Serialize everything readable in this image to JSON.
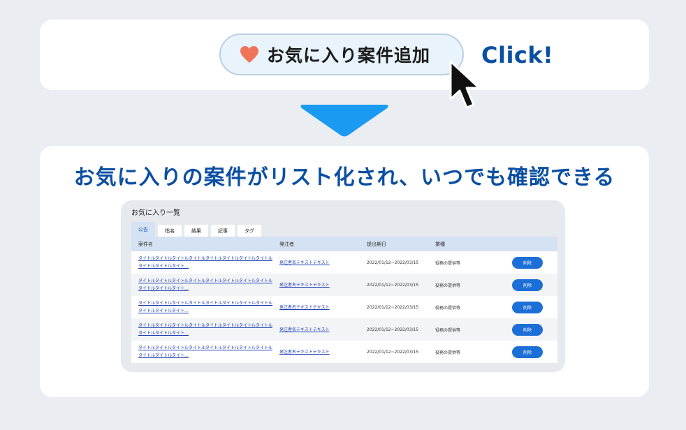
{
  "top": {
    "button_label": "お気に入り案件追加",
    "click_label": "Click!"
  },
  "bottom": {
    "headline": "お気に入りの案件がリスト化され、いつでも確認できる",
    "panel": {
      "title": "お気に入り一覧",
      "tabs": [
        {
          "label": "公告",
          "active": true
        },
        {
          "label": "指名",
          "active": false
        },
        {
          "label": "結果",
          "active": false
        },
        {
          "label": "記事",
          "active": false
        },
        {
          "label": "タグ",
          "active": false
        }
      ],
      "columns": [
        "案件名",
        "発注者",
        "提出期日",
        "業種"
      ],
      "rows": [
        {
          "title_line1": "タイトルタイトルタイトルタイトルタイトルタイトルタイトルタイトル",
          "title_line2": "タイトルタイトルタイト…",
          "orderer": "発注者名テキストテキスト",
          "period": "2022/01/12~2022/03/15",
          "industry": "役務の提供等",
          "action": "削除"
        },
        {
          "title_line1": "タイトルタイトルタイトルタイトルタイトルタイトルタイトルタイトル",
          "title_line2": "タイトルタイトルタイト…",
          "orderer": "発注者名テキストテキスト",
          "period": "2022/01/12~2022/03/15",
          "industry": "役務の提供等",
          "action": "削除"
        },
        {
          "title_line1": "タイトルタイトルタイトルタイトルタイトルタイトルタイトルタイトル",
          "title_line2": "タイトルタイトルタイト…",
          "orderer": "発注者名テキストテキスト",
          "period": "2022/01/12~2022/03/15",
          "industry": "役務の提供等",
          "action": "削除"
        },
        {
          "title_line1": "タイトルタイトルタイトルタイトルタイトルタイトルタイトルタイトル",
          "title_line2": "タイトルタイトルタイト…",
          "orderer": "発注者名テキストテキスト",
          "period": "2022/01/12~2022/03/15",
          "industry": "役務の提供等",
          "action": "削除"
        },
        {
          "title_line1": "タイトルタイトルタイトルタイトルタイトルタイトルタイトルタイトル",
          "title_line2": "タイトルタイトルタイト…",
          "orderer": "発注者名テキストテキスト",
          "period": "2022/01/12~2022/03/15",
          "industry": "役務の提供等",
          "action": "削除"
        }
      ]
    }
  },
  "colors": {
    "background": "#eaeef3",
    "accent_blue": "#0b4fa3",
    "arrow_blue": "#1a9af0",
    "button_blue": "#1b6fd6",
    "heart": "#f0745a",
    "header_row": "#d4e2f3"
  },
  "icons": {
    "heart": "heart-icon",
    "cursor": "mouse-pointer-icon",
    "arrow": "down-arrow-icon"
  }
}
